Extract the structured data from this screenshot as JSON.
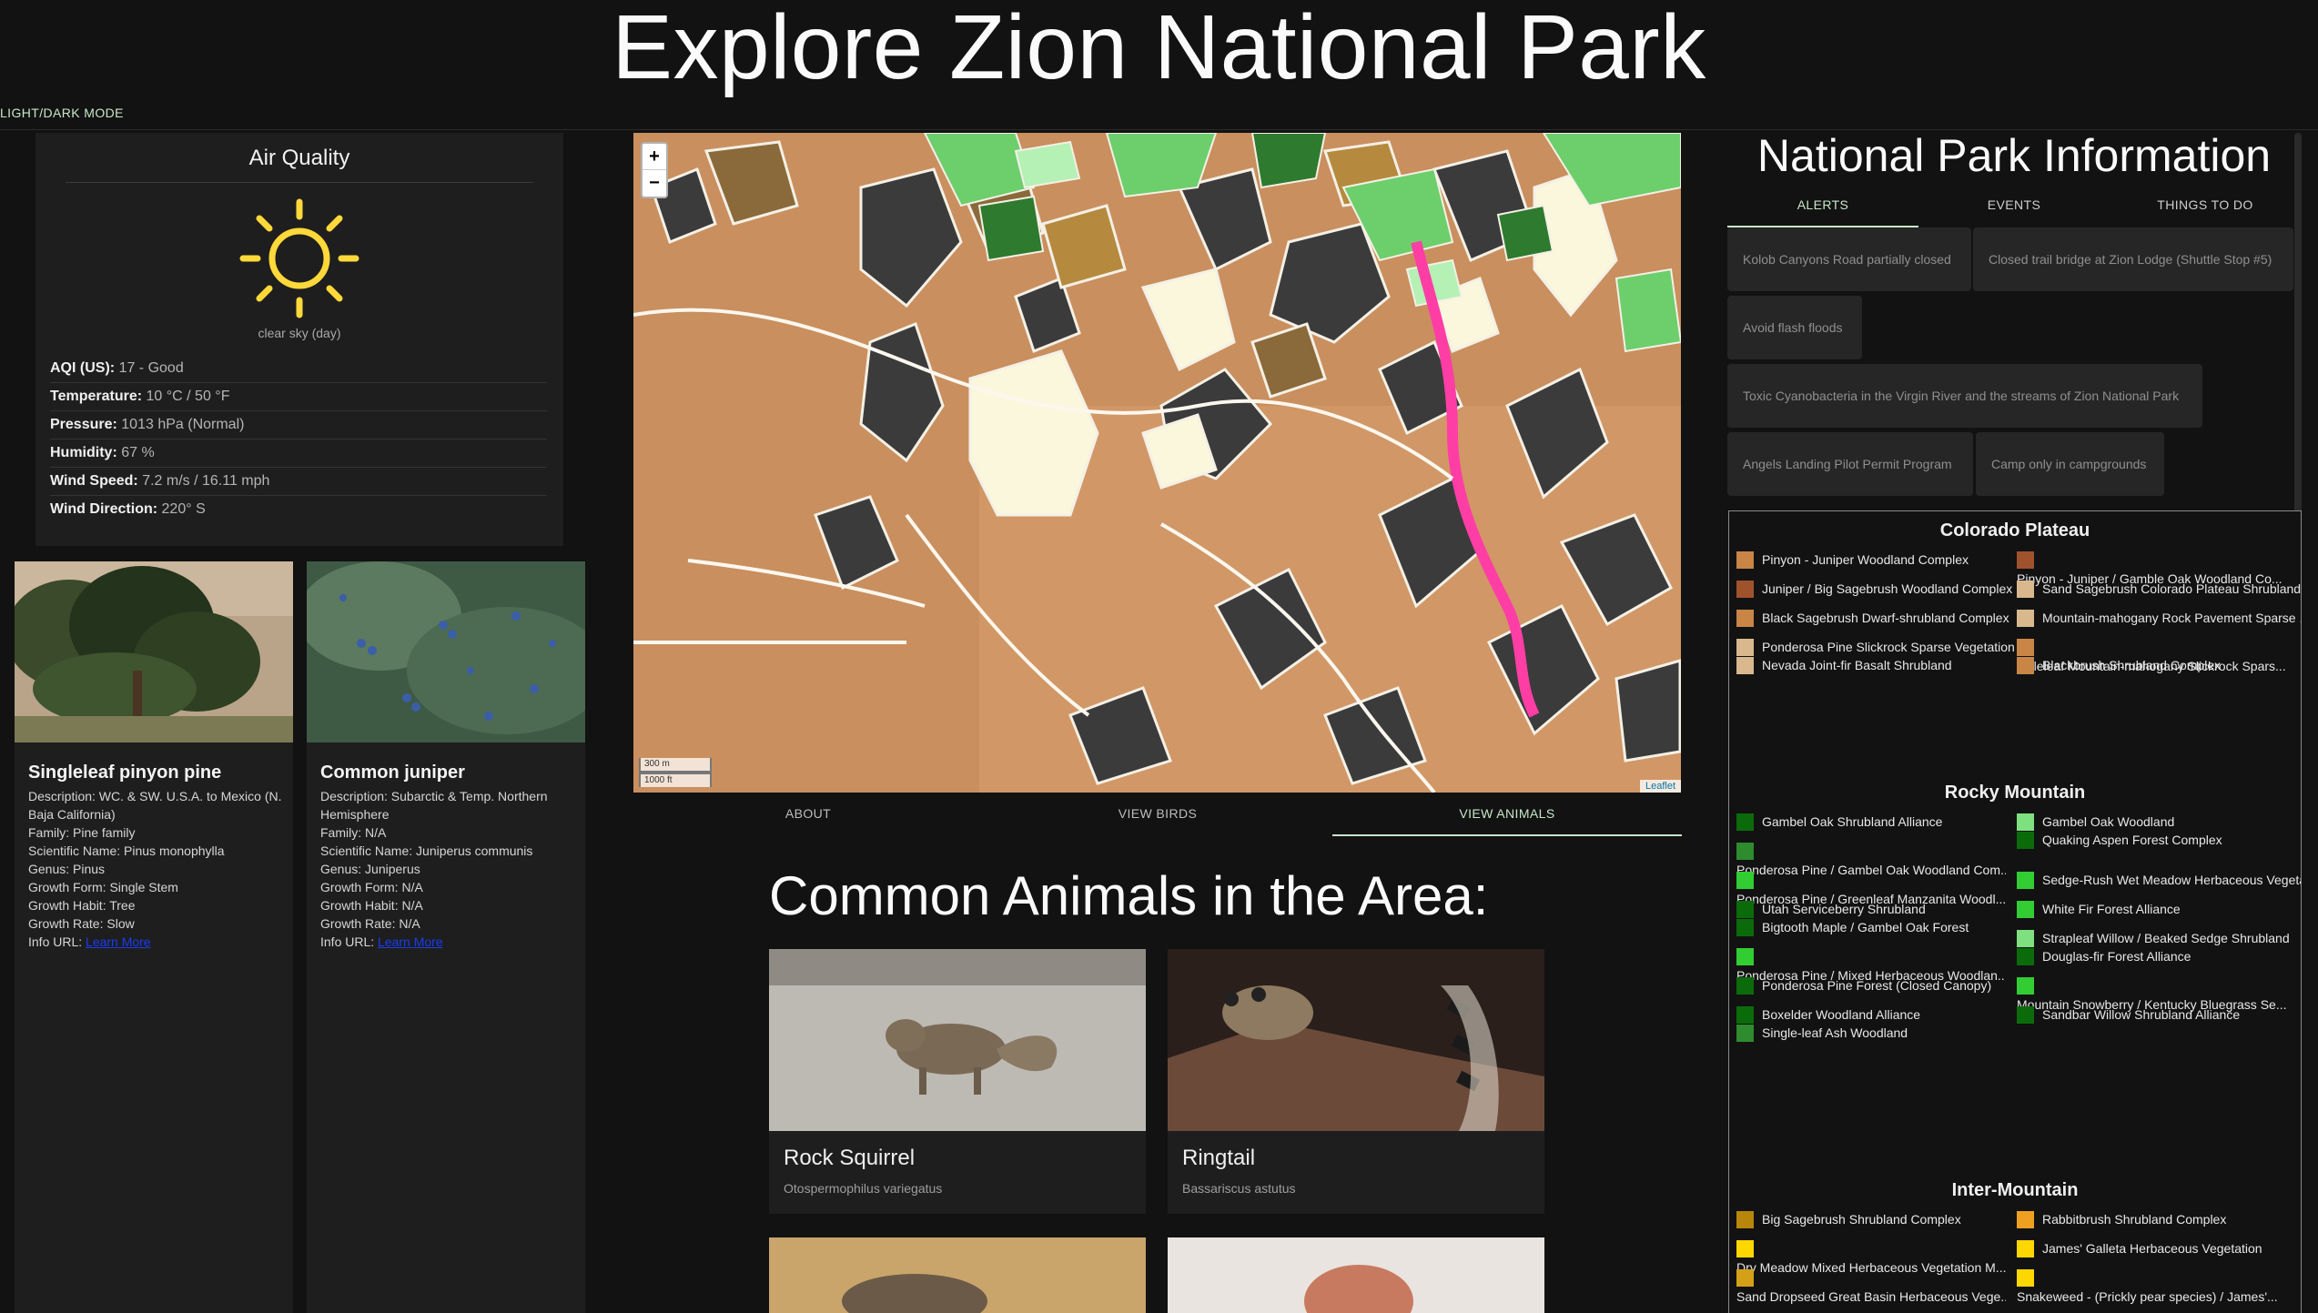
{
  "header": {
    "title": "Explore Zion National Park",
    "mode_toggle": "LIGHT/DARK MODE"
  },
  "air_quality": {
    "title": "Air Quality",
    "condition": "clear sky (day)",
    "icon": "sun-icon",
    "rows": [
      {
        "label": "AQI (US):",
        "value": "17 - Good"
      },
      {
        "label": "Temperature:",
        "value": "10 °C / 50 °F"
      },
      {
        "label": "Pressure:",
        "value": "1013 hPa (Normal)"
      },
      {
        "label": "Humidity:",
        "value": "67 %"
      },
      {
        "label": "Wind Speed:",
        "value": "7.2 m/s / 16.11 mph"
      },
      {
        "label": "Wind Direction:",
        "value": "220° S"
      }
    ]
  },
  "plants": [
    {
      "name": "Singleleaf pinyon pine",
      "description": "Description: WC. & SW. U.S.A. to Mexico (N. Baja California)",
      "family": "Family: Pine family",
      "scientific": "Scientific Name: Pinus monophylla",
      "genus": "Genus: Pinus",
      "growth_form": "Growth Form: Single Stem",
      "growth_habit": "Growth Habit: Tree",
      "growth_rate": "Growth Rate: Slow",
      "info_label": "Info URL: ",
      "info_link": "Learn More"
    },
    {
      "name": "Common juniper",
      "description": "Description: Subarctic & Temp. Northern Hemisphere",
      "family": "Family: N/A",
      "scientific": "Scientific Name: Juniperus communis",
      "genus": "Genus: Juniperus",
      "growth_form": "Growth Form: N/A",
      "growth_habit": "Growth Habit: N/A",
      "growth_rate": "Growth Rate: N/A",
      "info_label": "Info URL: ",
      "info_link": "Learn More"
    }
  ],
  "map": {
    "zoom_in": "+",
    "zoom_out": "−",
    "scale_metric": "300 m",
    "scale_imperial": "1000 ft",
    "attribution": "Leaflet"
  },
  "map_tabs": [
    "ABOUT",
    "VIEW BIRDS",
    "VIEW ANIMALS"
  ],
  "animals": {
    "title": "Common Animals in the Area:",
    "items": [
      {
        "name": "Rock Squirrel",
        "scientific": "Otospermophilus variegatus"
      },
      {
        "name": "Ringtail",
        "scientific": "Bassariscus astutus"
      }
    ]
  },
  "park_info": {
    "title": "National Park Information",
    "tabs": [
      "ALERTS",
      "EVENTS",
      "THINGS TO DO"
    ],
    "alerts": [
      "Kolob Canyons Road partially closed",
      "Closed trail bridge at Zion Lodge (Shuttle Stop #5)",
      "Avoid flash floods",
      "Toxic Cyanobacteria in the Virgin River and the streams of Zion National Park",
      "Angels Landing Pilot Permit Program",
      "Camp only in campgrounds"
    ]
  },
  "legend": {
    "sections": [
      {
        "title": "Colorado Plateau",
        "items": [
          {
            "label": "Pinyon - Juniper Woodland Complex",
            "color": "#c98545"
          },
          {
            "label": "Pinyon - Juniper / Gamble Oak Woodland Co...",
            "color": "#a0522d"
          },
          {
            "label": "Juniper / Big Sagebrush Woodland Complex",
            "color": "#a0522d"
          },
          {
            "label": "Sand Sagebrush Colorado Plateau Shrubland",
            "color": "#d8b88c"
          },
          {
            "label": "Black Sagebrush Dwarf-shrubland Complex",
            "color": "#c98545"
          },
          {
            "label": "Mountain-mahogany Rock Pavement Sparse ...",
            "color": "#d8b88c"
          },
          {
            "label": "Ponderosa Pine Slickrock Sparse Vegetation",
            "color": "#d8b88c"
          },
          {
            "label": "Littleleaf Mountain-mahogany Slickrock Spars...",
            "color": "#c98545"
          },
          {
            "label": "Nevada Joint-fir Basalt Shrubland",
            "color": "#d8b88c"
          },
          {
            "label": "Blackbrush Shrubland Complex",
            "color": "#c98545"
          }
        ]
      },
      {
        "title": "Rocky Mountain",
        "items": [
          {
            "label": "Gambel Oak Shrubland Alliance",
            "color": "#0b6b0b"
          },
          {
            "label": "Gambel Oak Woodland",
            "color": "#7ee07e"
          },
          {
            "label": "Ponderosa Pine / Gambel Oak Woodland Com...",
            "color": "#2e8b2e"
          },
          {
            "label": "Quaking Aspen Forest Complex",
            "color": "#0b6b0b"
          },
          {
            "label": "Ponderosa Pine / Greenleaf Manzanita Woodl...",
            "color": "#32cd32"
          },
          {
            "label": "Sedge-Rush Wet Meadow Herbaceous Vegeta...",
            "color": "#32cd32"
          },
          {
            "label": "Utah Serviceberry Shrubland",
            "color": "#0b6b0b"
          },
          {
            "label": "White Fir Forest Alliance",
            "color": "#32cd32"
          },
          {
            "label": "Bigtooth Maple / Gambel Oak Forest",
            "color": "#0b6b0b"
          },
          {
            "label": "Strapleaf Willow / Beaked Sedge Shrubland",
            "color": "#7ee07e"
          },
          {
            "label": "Ponderosa Pine / Mixed Herbaceous Woodlan...",
            "color": "#32cd32"
          },
          {
            "label": "Douglas-fir Forest Alliance",
            "color": "#0b6b0b"
          },
          {
            "label": "Ponderosa Pine Forest (Closed Canopy)",
            "color": "#0b6b0b"
          },
          {
            "label": "Mountain Snowberry / Kentucky Bluegrass Se...",
            "color": "#32cd32"
          },
          {
            "label": "Boxelder Woodland Alliance",
            "color": "#0b6b0b"
          },
          {
            "label": "Sandbar Willow Shrubland Alliance",
            "color": "#0b6b0b"
          },
          {
            "label": "Single-leaf Ash Woodland",
            "color": "#2e8b2e"
          }
        ]
      },
      {
        "title": "Inter-Mountain",
        "items": [
          {
            "label": "Big Sagebrush Shrubland Complex",
            "color": "#b8860b"
          },
          {
            "label": "Rabbitbrush Shrubland Complex",
            "color": "#f0a020"
          },
          {
            "label": "Dry Meadow Mixed Herbaceous Vegetation M...",
            "color": "#ffd700"
          },
          {
            "label": "James' Galleta Herbaceous Vegetation",
            "color": "#ffd700"
          },
          {
            "label": "Sand Dropseed Great Basin Herbaceous Vege...",
            "color": "#d4a017"
          },
          {
            "label": "Snakeweed - (Prickly pear species) / James'...",
            "color": "#ffd700"
          }
        ]
      }
    ]
  }
}
